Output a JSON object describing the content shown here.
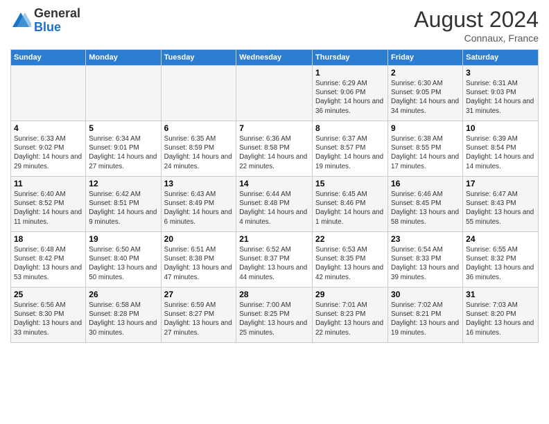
{
  "header": {
    "logo_general": "General",
    "logo_blue": "Blue",
    "month_year": "August 2024",
    "location": "Connaux, France"
  },
  "days_of_week": [
    "Sunday",
    "Monday",
    "Tuesday",
    "Wednesday",
    "Thursday",
    "Friday",
    "Saturday"
  ],
  "weeks": [
    [
      {
        "day": "",
        "info": ""
      },
      {
        "day": "",
        "info": ""
      },
      {
        "day": "",
        "info": ""
      },
      {
        "day": "",
        "info": ""
      },
      {
        "day": "1",
        "info": "Sunrise: 6:29 AM\nSunset: 9:06 PM\nDaylight: 14 hours and 36 minutes."
      },
      {
        "day": "2",
        "info": "Sunrise: 6:30 AM\nSunset: 9:05 PM\nDaylight: 14 hours and 34 minutes."
      },
      {
        "day": "3",
        "info": "Sunrise: 6:31 AM\nSunset: 9:03 PM\nDaylight: 14 hours and 31 minutes."
      }
    ],
    [
      {
        "day": "4",
        "info": "Sunrise: 6:33 AM\nSunset: 9:02 PM\nDaylight: 14 hours and 29 minutes."
      },
      {
        "day": "5",
        "info": "Sunrise: 6:34 AM\nSunset: 9:01 PM\nDaylight: 14 hours and 27 minutes."
      },
      {
        "day": "6",
        "info": "Sunrise: 6:35 AM\nSunset: 8:59 PM\nDaylight: 14 hours and 24 minutes."
      },
      {
        "day": "7",
        "info": "Sunrise: 6:36 AM\nSunset: 8:58 PM\nDaylight: 14 hours and 22 minutes."
      },
      {
        "day": "8",
        "info": "Sunrise: 6:37 AM\nSunset: 8:57 PM\nDaylight: 14 hours and 19 minutes."
      },
      {
        "day": "9",
        "info": "Sunrise: 6:38 AM\nSunset: 8:55 PM\nDaylight: 14 hours and 17 minutes."
      },
      {
        "day": "10",
        "info": "Sunrise: 6:39 AM\nSunset: 8:54 PM\nDaylight: 14 hours and 14 minutes."
      }
    ],
    [
      {
        "day": "11",
        "info": "Sunrise: 6:40 AM\nSunset: 8:52 PM\nDaylight: 14 hours and 11 minutes."
      },
      {
        "day": "12",
        "info": "Sunrise: 6:42 AM\nSunset: 8:51 PM\nDaylight: 14 hours and 9 minutes."
      },
      {
        "day": "13",
        "info": "Sunrise: 6:43 AM\nSunset: 8:49 PM\nDaylight: 14 hours and 6 minutes."
      },
      {
        "day": "14",
        "info": "Sunrise: 6:44 AM\nSunset: 8:48 PM\nDaylight: 14 hours and 4 minutes."
      },
      {
        "day": "15",
        "info": "Sunrise: 6:45 AM\nSunset: 8:46 PM\nDaylight: 14 hours and 1 minute."
      },
      {
        "day": "16",
        "info": "Sunrise: 6:46 AM\nSunset: 8:45 PM\nDaylight: 13 hours and 58 minutes."
      },
      {
        "day": "17",
        "info": "Sunrise: 6:47 AM\nSunset: 8:43 PM\nDaylight: 13 hours and 55 minutes."
      }
    ],
    [
      {
        "day": "18",
        "info": "Sunrise: 6:48 AM\nSunset: 8:42 PM\nDaylight: 13 hours and 53 minutes."
      },
      {
        "day": "19",
        "info": "Sunrise: 6:50 AM\nSunset: 8:40 PM\nDaylight: 13 hours and 50 minutes."
      },
      {
        "day": "20",
        "info": "Sunrise: 6:51 AM\nSunset: 8:38 PM\nDaylight: 13 hours and 47 minutes."
      },
      {
        "day": "21",
        "info": "Sunrise: 6:52 AM\nSunset: 8:37 PM\nDaylight: 13 hours and 44 minutes."
      },
      {
        "day": "22",
        "info": "Sunrise: 6:53 AM\nSunset: 8:35 PM\nDaylight: 13 hours and 42 minutes."
      },
      {
        "day": "23",
        "info": "Sunrise: 6:54 AM\nSunset: 8:33 PM\nDaylight: 13 hours and 39 minutes."
      },
      {
        "day": "24",
        "info": "Sunrise: 6:55 AM\nSunset: 8:32 PM\nDaylight: 13 hours and 36 minutes."
      }
    ],
    [
      {
        "day": "25",
        "info": "Sunrise: 6:56 AM\nSunset: 8:30 PM\nDaylight: 13 hours and 33 minutes."
      },
      {
        "day": "26",
        "info": "Sunrise: 6:58 AM\nSunset: 8:28 PM\nDaylight: 13 hours and 30 minutes."
      },
      {
        "day": "27",
        "info": "Sunrise: 6:59 AM\nSunset: 8:27 PM\nDaylight: 13 hours and 27 minutes."
      },
      {
        "day": "28",
        "info": "Sunrise: 7:00 AM\nSunset: 8:25 PM\nDaylight: 13 hours and 25 minutes."
      },
      {
        "day": "29",
        "info": "Sunrise: 7:01 AM\nSunset: 8:23 PM\nDaylight: 13 hours and 22 minutes."
      },
      {
        "day": "30",
        "info": "Sunrise: 7:02 AM\nSunset: 8:21 PM\nDaylight: 13 hours and 19 minutes."
      },
      {
        "day": "31",
        "info": "Sunrise: 7:03 AM\nSunset: 8:20 PM\nDaylight: 13 hours and 16 minutes."
      }
    ]
  ]
}
